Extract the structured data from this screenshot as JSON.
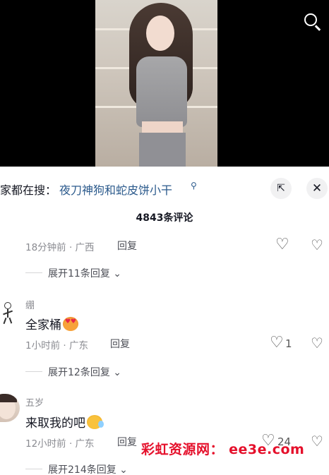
{
  "search_bar": {
    "prefix": "家都在搜：",
    "trend": "夜刀神狗和蛇皮饼小干",
    "trend_icon": "search-small-icon",
    "expand_icon": "expand-icon",
    "close_icon": "close-icon"
  },
  "comments_header": {
    "count_label": "4843条评论"
  },
  "comments": [
    {
      "username": "",
      "text": "",
      "meta": "18分钟前 · 广西",
      "reply": "回复",
      "likes": "",
      "expand": "展开11条回复"
    },
    {
      "username": "绷",
      "text": "全家桶",
      "emoji": "heart-eyes-emoji",
      "meta": "1小时前 · 广东",
      "reply": "回复",
      "likes": "1",
      "expand": "展开12条回复"
    },
    {
      "username": "五岁",
      "text": "来取我的吧",
      "emoji": "crying-emoji",
      "meta": "12小时前 · 广东",
      "reply": "回复",
      "likes": "24",
      "expand": "展开214条回复"
    }
  ],
  "watermark": "彩虹资源网： ee3e.com",
  "colors": {
    "link": "#2b5a8c",
    "meta": "#8a8b91",
    "watermark": "#e5102b"
  }
}
